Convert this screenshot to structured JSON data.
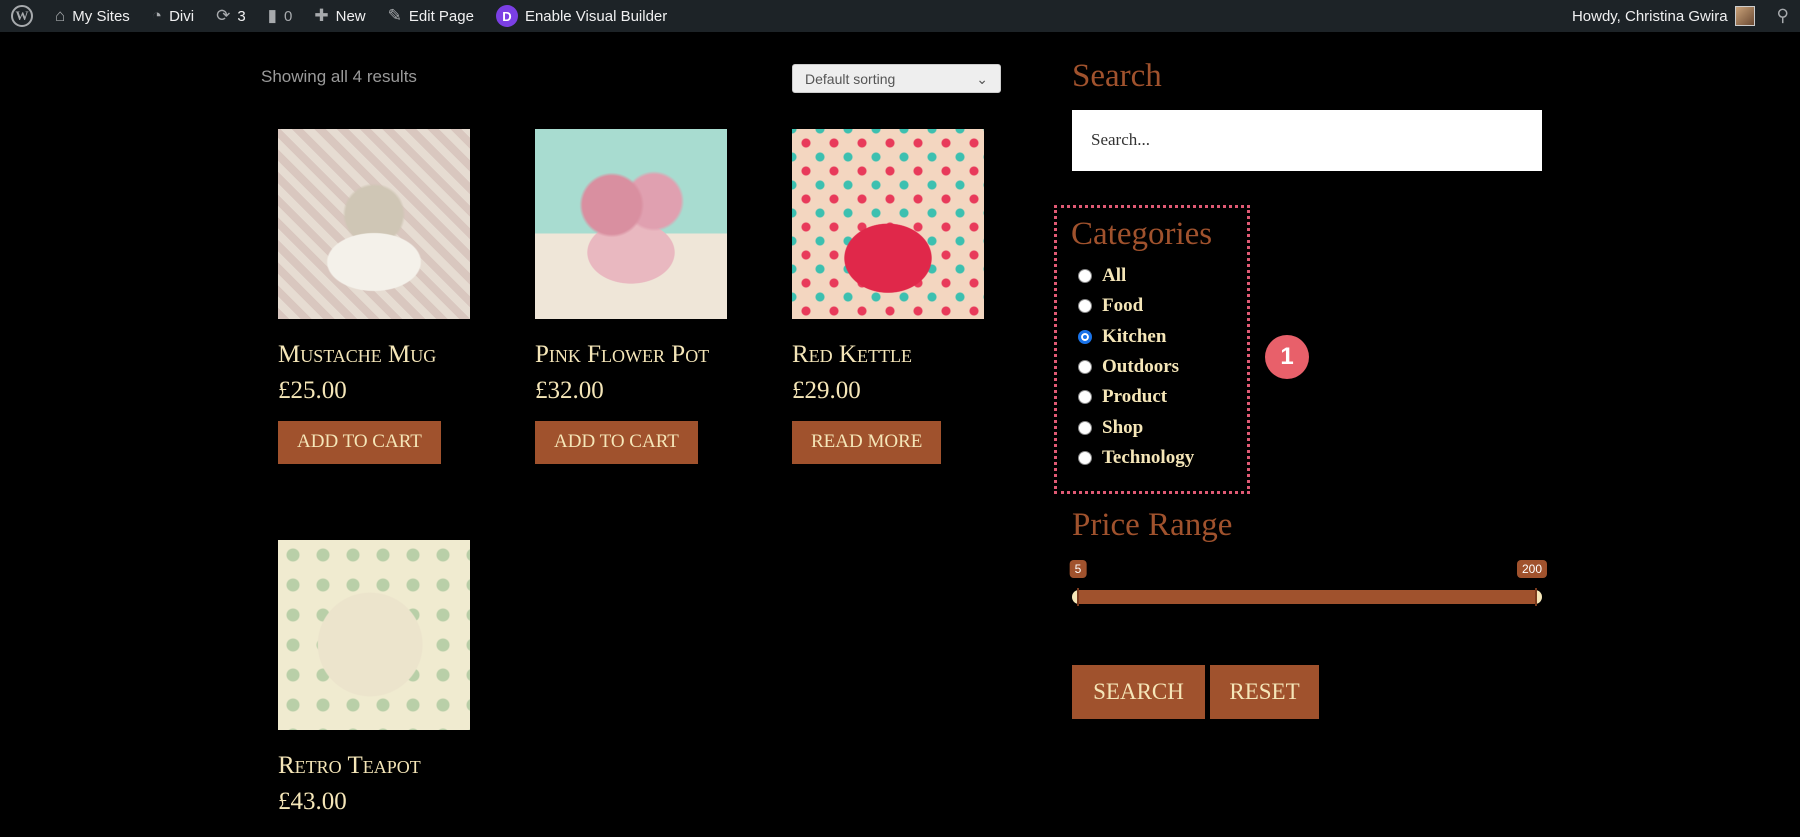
{
  "adminbar": {
    "my_sites": "My Sites",
    "divi": "Divi",
    "updates": "3",
    "comments": "0",
    "new": "New",
    "edit_page": "Edit Page",
    "visual_builder": "Enable Visual Builder",
    "howdy": "Howdy, Christina Gwira"
  },
  "shop": {
    "results": "Showing all 4 results",
    "sorting": "Default sorting",
    "products": [
      {
        "title": "Mustache Mug",
        "price": "£25.00",
        "button": "ADD TO CART"
      },
      {
        "title": "Pink Flower Pot",
        "price": "£32.00",
        "button": "ADD TO CART"
      },
      {
        "title": "Red Kettle",
        "price": "£29.00",
        "button": "READ MORE"
      },
      {
        "title": "Retro Teapot",
        "price": "£43.00"
      }
    ]
  },
  "sidebar": {
    "search_title": "Search",
    "search_placeholder": "Search...",
    "categories_title": "Categories",
    "categories": [
      {
        "label": "All",
        "checked": false
      },
      {
        "label": "Food",
        "checked": false
      },
      {
        "label": "Kitchen",
        "checked": true
      },
      {
        "label": "Outdoors",
        "checked": false
      },
      {
        "label": "Product",
        "checked": false
      },
      {
        "label": "Shop",
        "checked": false
      },
      {
        "label": "Technology",
        "checked": false
      }
    ],
    "price_title": "Price Range",
    "price_min": "5",
    "price_max": "200",
    "search_button": "SEARCH",
    "reset_button": "RESET"
  },
  "annotation": "1",
  "colors": {
    "accent": "#a0522d",
    "text": "#f5e6b8",
    "annotation": "#e8606a"
  }
}
